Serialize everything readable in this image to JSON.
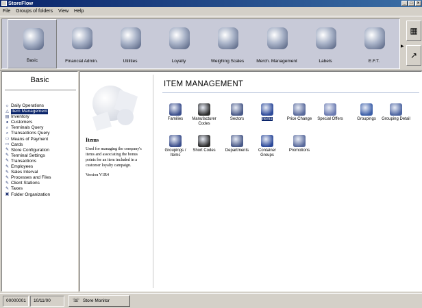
{
  "window": {
    "title": "StoreFlow",
    "controls": [
      "_",
      "□",
      "×"
    ]
  },
  "menu": [
    {
      "label": "File"
    },
    {
      "label": "Groups of folders"
    },
    {
      "label": "View"
    },
    {
      "label": "Help"
    }
  ],
  "toolbar": {
    "items": [
      {
        "label": "Basic",
        "icon": "folder-icon"
      },
      {
        "label": "Financial Admin.",
        "icon": "building-icon"
      },
      {
        "label": "Utilities",
        "icon": "tools-icon"
      },
      {
        "label": "Loyalty",
        "icon": "person-icon"
      },
      {
        "label": "Weighing Scales",
        "icon": "scales-icon"
      },
      {
        "label": "Merch. Management",
        "icon": "products-icon"
      },
      {
        "label": "Labels",
        "icon": "labels-icon"
      },
      {
        "label": "E.F.T.",
        "icon": "card-icon"
      }
    ],
    "side_icons": [
      "▦",
      "↗"
    ]
  },
  "left": {
    "title": "Basic",
    "items": [
      {
        "label": "Daily Operations",
        "glyph": "☼"
      },
      {
        "label": "Item Management",
        "glyph": "△"
      },
      {
        "label": "Inventory",
        "glyph": "▤"
      },
      {
        "label": "Customers",
        "glyph": "●"
      },
      {
        "label": "Terminals Query",
        "glyph": "⌕"
      },
      {
        "label": "Transactions Query",
        "glyph": "⌕"
      },
      {
        "label": "Means of Payment",
        "glyph": "▭"
      },
      {
        "label": "Cards",
        "glyph": "▭"
      },
      {
        "label": "Store Configuration",
        "glyph": "✎"
      },
      {
        "label": "Terminal Settings",
        "glyph": "✎"
      },
      {
        "label": "Transactions",
        "glyph": "✎"
      },
      {
        "label": "Employees",
        "glyph": "✎"
      },
      {
        "label": "Sales Interval",
        "glyph": "✎"
      },
      {
        "label": "Processes and Files",
        "glyph": "✎"
      },
      {
        "label": "Client Stations",
        "glyph": "✎"
      },
      {
        "label": "Taxes",
        "glyph": "✎"
      },
      {
        "label": "Folder Organization",
        "glyph": "▣"
      }
    ]
  },
  "main": {
    "heading": "ITEM MANAGEMENT",
    "info": {
      "title": "Items",
      "description": "Used for managing the company's items and associating the bonus points for an item included in a customer loyalty campaign.",
      "version": "Version V1R4"
    },
    "row1": [
      {
        "label": "Families",
        "icon": "families-icon"
      },
      {
        "label": "Manufacturer Codes",
        "icon": "barcode-icon"
      },
      {
        "label": "Sectors",
        "icon": "sectors-icon"
      },
      {
        "label": "Items",
        "icon": "items-icon"
      },
      {
        "label": "Price Change",
        "icon": "price-change-icon"
      },
      {
        "label": "Special Offers",
        "icon": "special-offers-icon"
      },
      {
        "label": "Groupings",
        "icon": "groupings-icon"
      },
      {
        "label": "Grouping Detail",
        "icon": "grouping-detail-icon"
      }
    ],
    "row2": [
      {
        "label": "Groupings / Items",
        "icon": "groupings-items-icon"
      },
      {
        "label": "Short Codes",
        "icon": "short-codes-icon"
      },
      {
        "label": "Departments",
        "icon": "departments-icon"
      },
      {
        "label": "Container Groups",
        "icon": "container-groups-icon"
      },
      {
        "label": "Promotions",
        "icon": "promotions-icon"
      }
    ]
  },
  "status": {
    "code": "00000001",
    "date": "10/11/00",
    "tab": "Store Monitor"
  }
}
